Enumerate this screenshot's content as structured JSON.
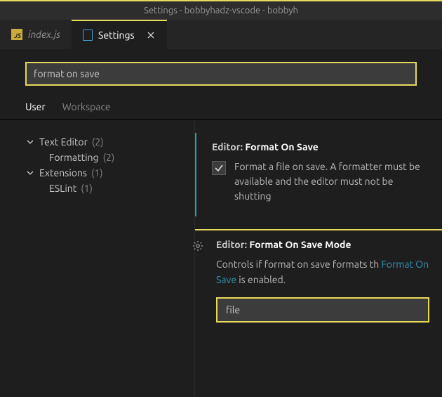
{
  "window": {
    "title": "Settings - bobbyhadz-vscode - bobbyh"
  },
  "tabs": {
    "index": {
      "label": "index.js",
      "jsBadge": "JS"
    },
    "settings": {
      "label": "Settings"
    }
  },
  "search": {
    "value": "format on save"
  },
  "scope": {
    "user": "User",
    "workspace": "Workspace"
  },
  "tree": {
    "textEditor": {
      "label": "Text Editor",
      "count": "(2)"
    },
    "formatting": {
      "label": "Formatting",
      "count": "(2)"
    },
    "extensions": {
      "label": "Extensions",
      "count": "(1)"
    },
    "eslint": {
      "label": "ESLint",
      "count": "(1)"
    }
  },
  "settingA": {
    "scope": "Editor: ",
    "name": "Format On Save",
    "desc": "Format a file on save. A formatter must be available and the editor must not be shutting"
  },
  "settingB": {
    "scope": "Editor: ",
    "name": "Format On Save Mode",
    "descPre": "Controls if format on save formats th",
    "link": "Format On Save",
    "descPost": " is enabled.",
    "value": "file"
  }
}
